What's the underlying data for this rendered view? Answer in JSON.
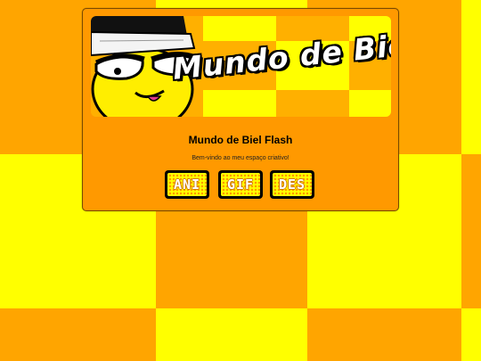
{
  "site": {
    "banner_logo_text": "Mundo de Biel",
    "title": "Mundo de Biel Flash",
    "welcome": "Bem-vindo ao meu espaço criativo!"
  },
  "nav": {
    "buttons": [
      {
        "label": "ANI",
        "icon": "pixel-text-button"
      },
      {
        "label": "GIF",
        "icon": "pixel-text-button"
      },
      {
        "label": "DES",
        "icon": "pixel-text-button"
      }
    ]
  },
  "colors": {
    "background_orange": "#ffa500",
    "background_yellow": "#ffff00",
    "card": "#ff9900",
    "text": "#000000"
  }
}
